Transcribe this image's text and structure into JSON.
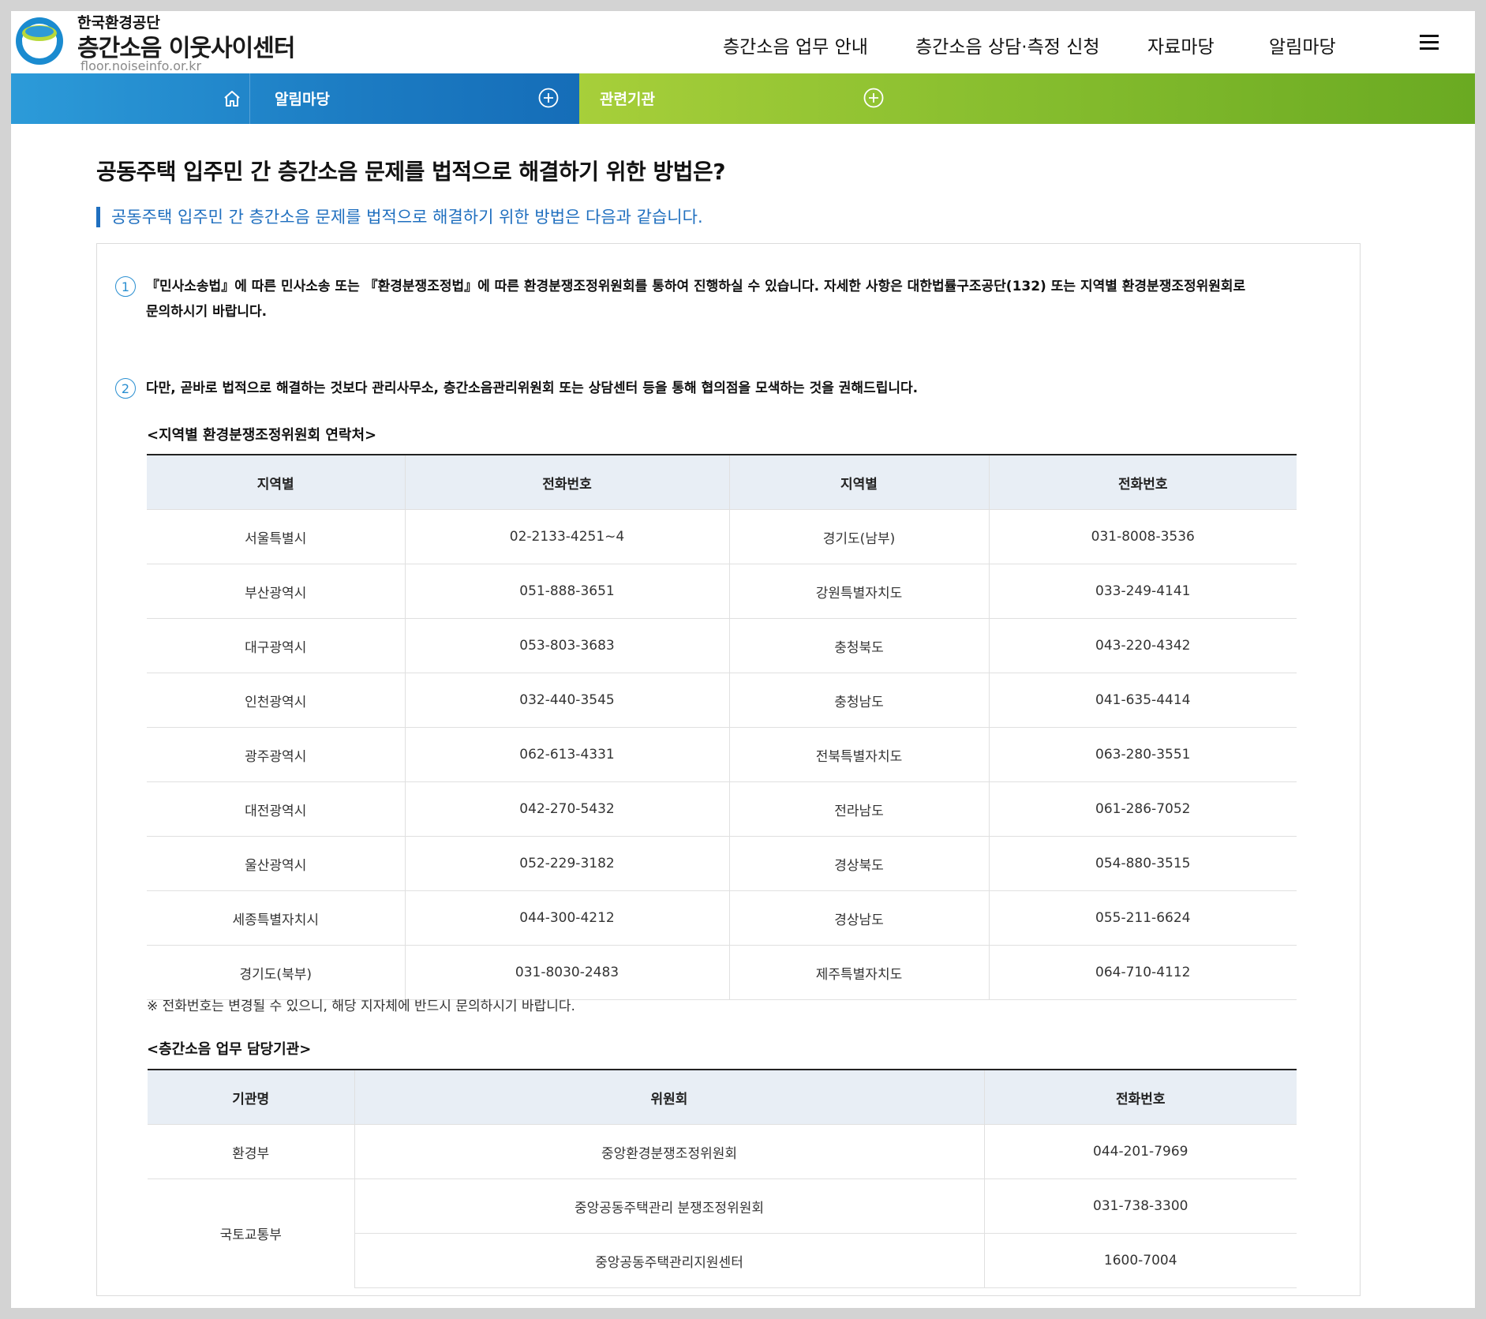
{
  "header": {
    "org_name": "한국환경공단",
    "site_name": "층간소음 이웃사이센터",
    "site_url": "floor.noiseinfo.or.kr",
    "nav": [
      "층간소음 업무 안내",
      "층간소음 상담·측정 신청",
      "자료마당",
      "알림마당"
    ],
    "menu_icon": "hamburger-icon"
  },
  "breadcrumb": {
    "home_icon": "home-icon",
    "level1": "알림마당",
    "level2": "관련기관",
    "expand_icon": "plus-circle-icon"
  },
  "content": {
    "title": "공동주택 입주민 간 층간소음 문제를 법적으로 해결하기 위한 방법은?",
    "subtitle": "공동주택 입주민 간 층간소음 문제를 법적으로 해결하기 위한 방법은 다음과 같습니다.",
    "items": [
      {
        "number": "1",
        "line1": "『민사소송법』에 따른 민사소송 또는 『환경분쟁조정법』에 따른 환경분쟁조정위원회를 통하여 진행하실 수 있습니다. 자세한 사항은 대한법률구조공단(132) 또는 지역별 환경분쟁조정위원회로",
        "line2": "문의하시기 바랍니다."
      },
      {
        "number": "2",
        "line1": "다만, 곧바로 법적으로 해결하는 것보다 관리사무소, 층간소음관리위원회 또는 상담센터 등을 통해 협의점을 모색하는 것을 권해드립니다."
      }
    ],
    "regional": {
      "title": "<지역별 환경분쟁조정위원회 연락처>",
      "headers": [
        "지역별",
        "전화번호",
        "지역별",
        "전화번호"
      ],
      "rows": [
        [
          "서울특별시",
          "02-2133-4251~4",
          "경기도(남부)",
          "031-8008-3536"
        ],
        [
          "부산광역시",
          "051-888-3651",
          "강원특별자치도",
          "033-249-4141"
        ],
        [
          "대구광역시",
          "053-803-3683",
          "충청북도",
          "043-220-4342"
        ],
        [
          "인천광역시",
          "032-440-3545",
          "충청남도",
          "041-635-4414"
        ],
        [
          "광주광역시",
          "062-613-4331",
          "전북특별자치도",
          "063-280-3551"
        ],
        [
          "대전광역시",
          "042-270-5432",
          "전라남도",
          "061-286-7052"
        ],
        [
          "울산광역시",
          "052-229-3182",
          "경상북도",
          "054-880-3515"
        ],
        [
          "세종특별자치시",
          "044-300-4212",
          "경상남도",
          "055-211-6624"
        ],
        [
          "경기도(북부)",
          "031-8030-2483",
          "제주특별자치도",
          "064-710-4112"
        ]
      ],
      "note": "※ 전화번호는 변경될 수 있으니, 해당 지자체에 반드시 문의하시기 바랍니다."
    },
    "agencies": {
      "title": "<층간소음 업무 담당기관>",
      "headers": [
        "기관명",
        "위원회",
        "전화번호"
      ],
      "row1": {
        "org": "환경부",
        "committee": "중앙환경분쟁조정위원회",
        "phone": "044-201-7969"
      },
      "row2": {
        "org": "국토교통부",
        "committee": "중앙공동주택관리 분쟁조정위원회",
        "phone": "031-738-3300"
      },
      "row3": {
        "committee": "중앙공동주택관리지원센터",
        "phone": "1600-7004"
      }
    }
  },
  "colors": {
    "accent_blue": "#1f6fbf",
    "bar_blue": "#1c7cc3",
    "bar_green": "#86bd2e",
    "table_header_bg": "#e8eef5"
  }
}
